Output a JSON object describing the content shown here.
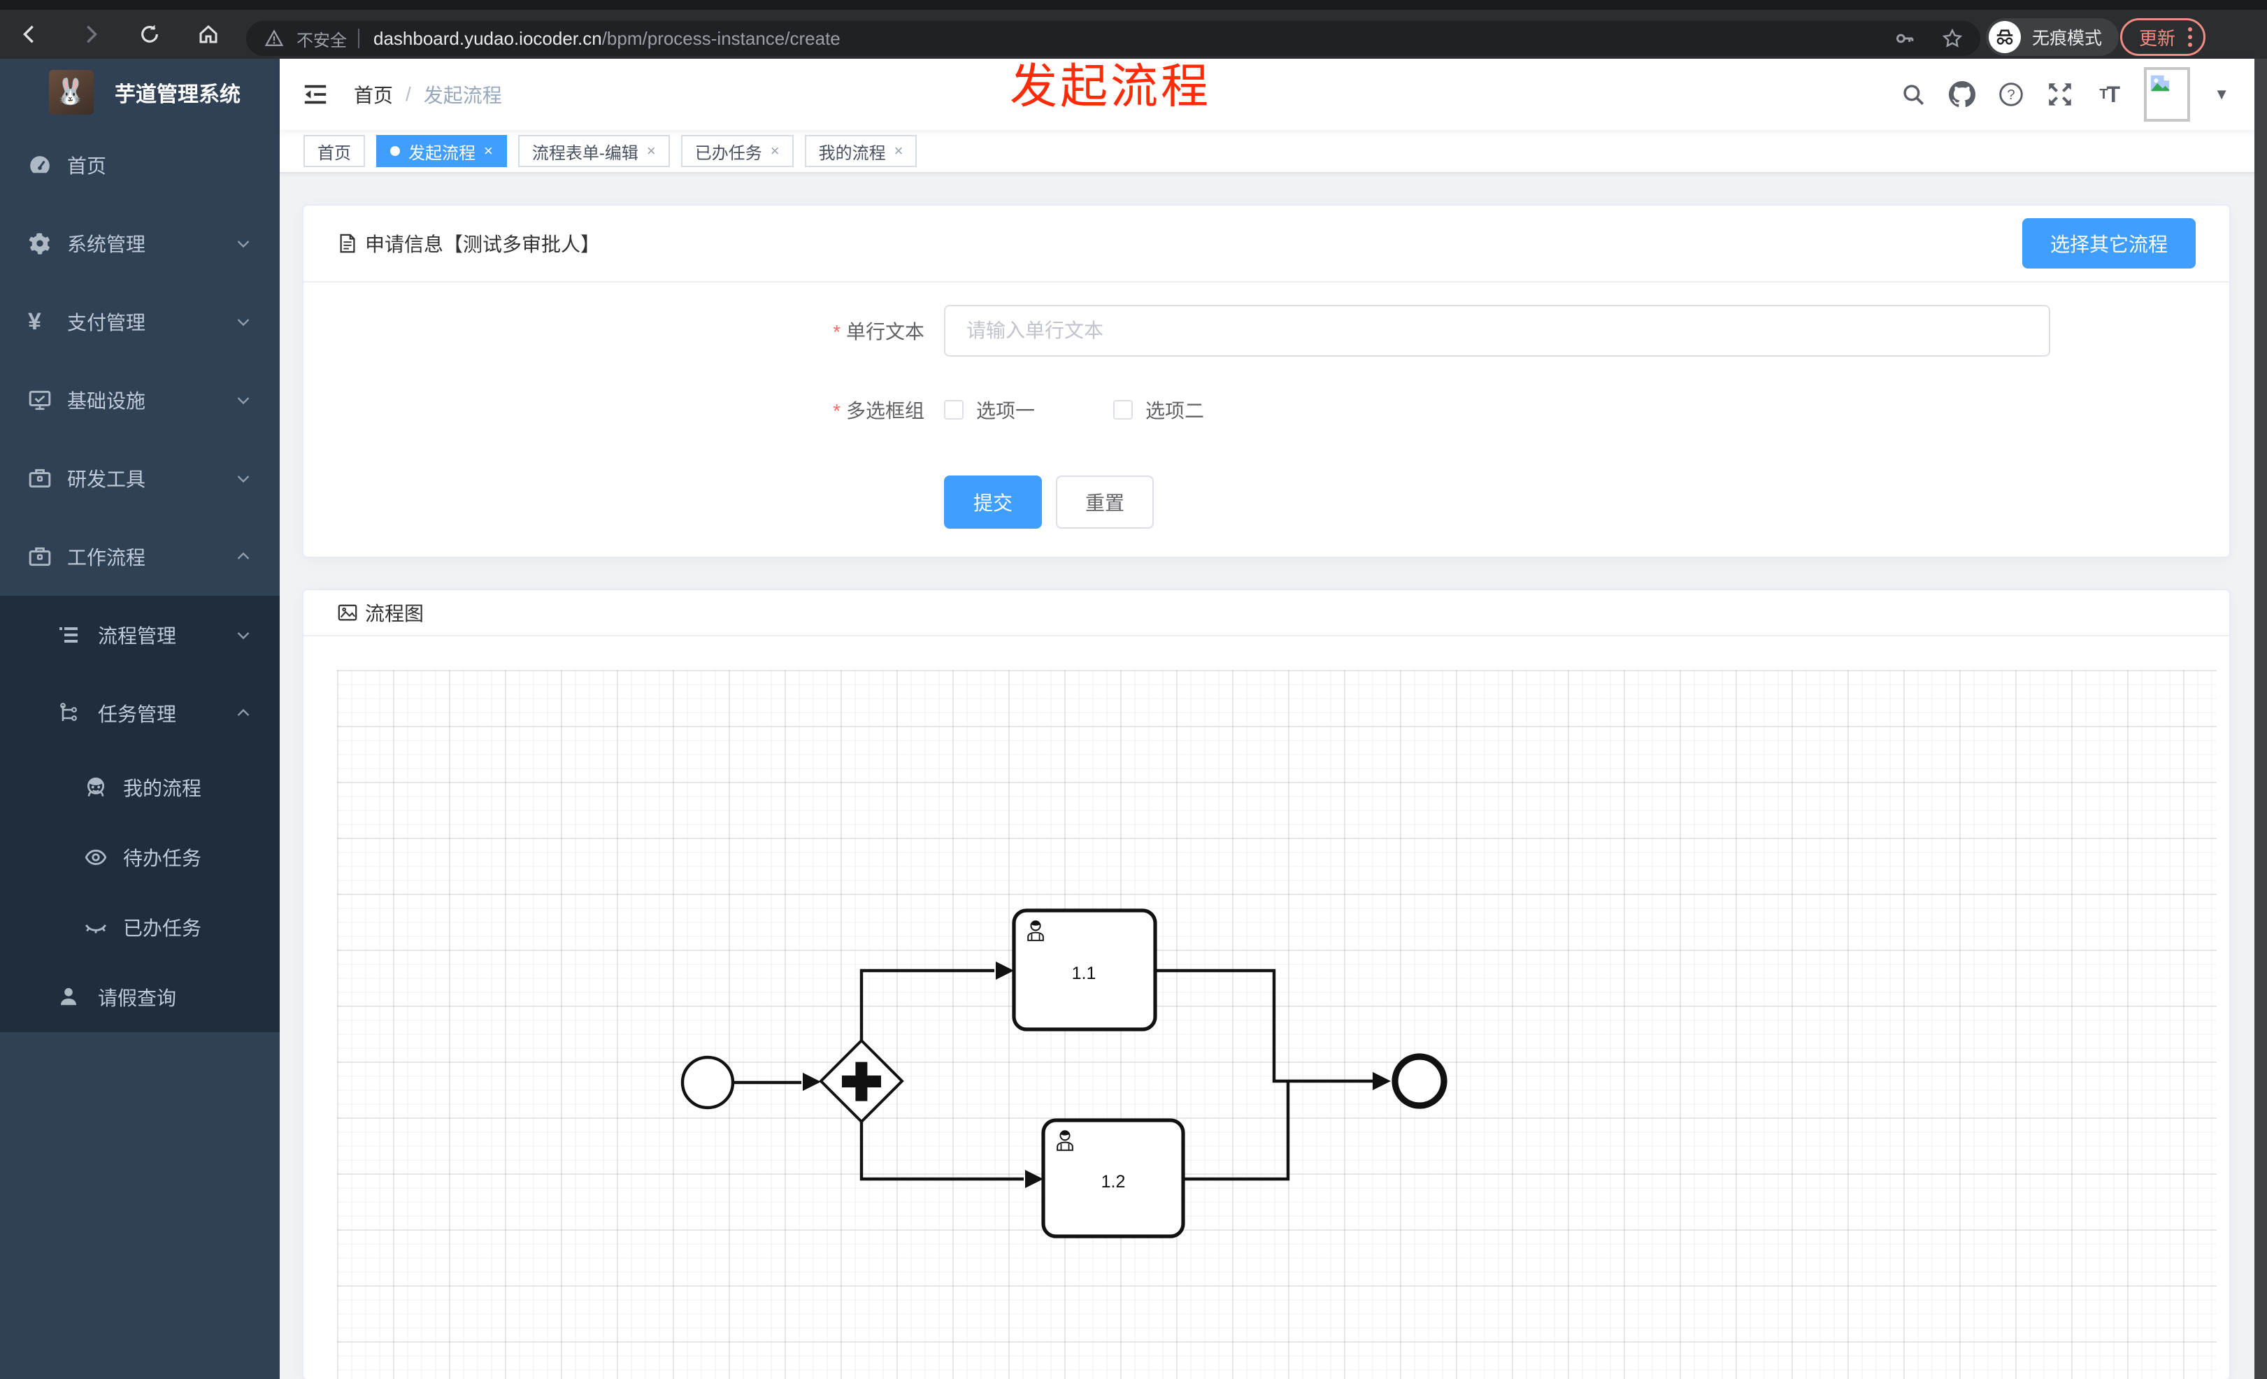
{
  "browser": {
    "security_label": "不安全",
    "url_host": "dashboard.yudao.iocoder.cn",
    "url_path": "/bpm/process-instance/create",
    "incognito_label": "无痕模式",
    "update_label": "更新"
  },
  "annotation": {
    "text": "发起流程",
    "color": "#ff2a06"
  },
  "sidebar": {
    "app_title": "芋道管理系统",
    "items": [
      {
        "label": "首页",
        "icon": "dashboard-icon",
        "level": 1
      },
      {
        "label": "系统管理",
        "icon": "gear-icon",
        "level": 1,
        "arrow": "down"
      },
      {
        "label": "支付管理",
        "icon": "yen-icon",
        "level": 1,
        "arrow": "down"
      },
      {
        "label": "基础设施",
        "icon": "monitor-icon",
        "level": 1,
        "arrow": "down"
      },
      {
        "label": "研发工具",
        "icon": "toolbox-icon",
        "level": 1,
        "arrow": "down"
      },
      {
        "label": "工作流程",
        "icon": "toolbox-icon",
        "level": 1,
        "arrow": "up"
      },
      {
        "label": "流程管理",
        "icon": "list-icon",
        "level": 2,
        "arrow": "down"
      },
      {
        "label": "任务管理",
        "icon": "tree-icon",
        "level": 2,
        "arrow": "up"
      },
      {
        "label": "我的流程",
        "icon": "face-icon",
        "level": 3
      },
      {
        "label": "待办任务",
        "icon": "eye-open-icon",
        "level": 3
      },
      {
        "label": "已办任务",
        "icon": "eye-closed-icon",
        "level": 3
      },
      {
        "label": "请假查询",
        "icon": "user-icon",
        "level": 2
      }
    ]
  },
  "header": {
    "breadcrumb": [
      "首页",
      "发起流程"
    ],
    "breadcrumb_separator": "/"
  },
  "tabs": [
    {
      "label": "首页",
      "active": false,
      "closable": false
    },
    {
      "label": "发起流程",
      "active": true,
      "closable": true
    },
    {
      "label": "流程表单-编辑",
      "active": false,
      "closable": true
    },
    {
      "label": "已办任务",
      "active": false,
      "closable": true
    },
    {
      "label": "我的流程",
      "active": false,
      "closable": true
    }
  ],
  "close_glyph": "×",
  "form_card": {
    "title": "申请信息【测试多审批人】",
    "choose_other_button": "选择其它流程",
    "fields": [
      {
        "label": "单行文本",
        "required": true,
        "type": "input",
        "placeholder": "请输入单行文本",
        "value": ""
      },
      {
        "label": "多选框组",
        "required": true,
        "type": "checkbox-group",
        "options": [
          {
            "label": "选项一",
            "checked": false
          },
          {
            "label": "选项二",
            "checked": false
          }
        ]
      }
    ],
    "submit_label": "提交",
    "reset_label": "重置"
  },
  "diagram_card": {
    "title": "流程图",
    "type": "bpmn-flow",
    "nodes": [
      {
        "id": "start",
        "type": "start-event",
        "label": ""
      },
      {
        "id": "gateway",
        "type": "parallel-gateway",
        "label": ""
      },
      {
        "id": "task-1",
        "type": "user-task",
        "label": "1.1"
      },
      {
        "id": "task-2",
        "type": "user-task",
        "label": "1.2"
      },
      {
        "id": "end",
        "type": "end-event",
        "label": ""
      }
    ],
    "edges": [
      "start → gateway",
      "gateway → task-1",
      "gateway → task-2",
      "task-1 → end",
      "task-2 → end"
    ]
  },
  "colors": {
    "accent": "#409eff",
    "sidebar_bg": "#304156",
    "submenu_bg": "#1f2d3d",
    "sidebar_text": "#bfcbd9",
    "annotation_red": "#ff2a06",
    "chrome_bg": "#2b2d30",
    "update_pill": "#f28b82"
  }
}
